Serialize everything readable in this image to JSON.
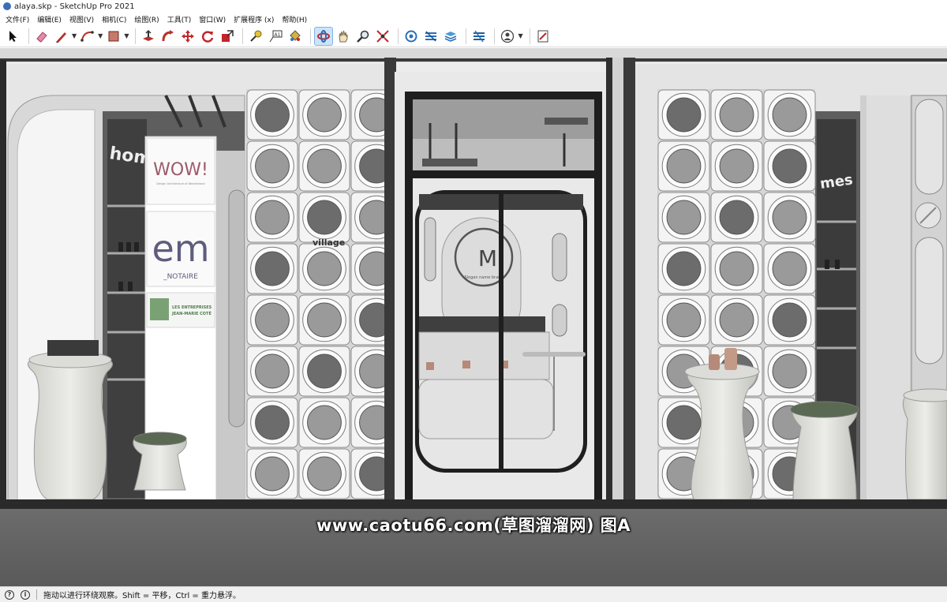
{
  "window": {
    "title": "alaya.skp - SketchUp Pro 2021"
  },
  "menu": [
    "文件(F)",
    "编辑(E)",
    "视图(V)",
    "相机(C)",
    "绘图(R)",
    "工具(T)",
    "窗口(W)",
    "扩展程序 (x)",
    "帮助(H)"
  ],
  "toolbar": {
    "tools": [
      "select-icon",
      "eraser-icon",
      "pencil-line-icon",
      "arc-icon",
      "rectangle-icon",
      "push-pull-icon",
      "follow-me-icon",
      "move-icon",
      "rotate-icon",
      "scale-icon",
      "tape-measure-icon",
      "text-icon",
      "paint-bucket-icon",
      "orbit-icon",
      "pan-icon",
      "zoom-icon",
      "zoom-extents-icon",
      "warehouse-icon",
      "extension-warehouse-icon",
      "layout-icon",
      "extension-manager-icon",
      "account-icon",
      "report-icon"
    ],
    "active_tool": "orbit-icon"
  },
  "scene": {
    "signs": {
      "wow": "WOW!",
      "wow_sub": "Design Architecture of Wonderland",
      "em": "em",
      "notaire": "_NOTAIRE",
      "entreprises_1": "LES ENTREPRISES",
      "entreprises_2": "JEAN-MARIE COTÉ",
      "village": "village",
      "logo": "M",
      "logo_sub": "Slogan name brand",
      "shelf_left": "hom",
      "shelf_right": "mes"
    }
  },
  "watermark": "www.caotu66.com(草图溜溜网) 图A",
  "status": {
    "message": "拖动以进行环绕观察。Shift = 平移，Ctrl = 重力悬浮。"
  }
}
